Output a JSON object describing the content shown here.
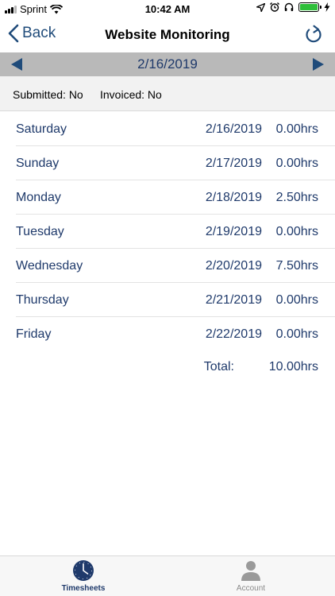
{
  "status_bar": {
    "carrier": "Sprint",
    "time": "10:42 AM",
    "icons": [
      "signal-icon",
      "wifi-icon",
      "location-icon",
      "alarm-icon",
      "headphones-icon",
      "battery-icon",
      "charging-icon"
    ]
  },
  "nav": {
    "back_label": "Back",
    "title": "Website Monitoring"
  },
  "date_bar": {
    "date": "2/16/2019"
  },
  "info": {
    "submitted": "Submitted: No",
    "invoiced": "Invoiced: No"
  },
  "days": [
    {
      "name": "Saturday",
      "date": "2/16/2019",
      "hours": "0.00hrs"
    },
    {
      "name": "Sunday",
      "date": "2/17/2019",
      "hours": "0.00hrs"
    },
    {
      "name": "Monday",
      "date": "2/18/2019",
      "hours": "2.50hrs"
    },
    {
      "name": "Tuesday",
      "date": "2/19/2019",
      "hours": "0.00hrs"
    },
    {
      "name": "Wednesday",
      "date": "2/20/2019",
      "hours": "7.50hrs"
    },
    {
      "name": "Thursday",
      "date": "2/21/2019",
      "hours": "0.00hrs"
    },
    {
      "name": "Friday",
      "date": "2/22/2019",
      "hours": "0.00hrs"
    }
  ],
  "total": {
    "label": "Total:",
    "value": "10.00hrs"
  },
  "tabs": [
    {
      "label": "Timesheets",
      "icon": "clock-icon",
      "active": true
    },
    {
      "label": "Account",
      "icon": "person-icon",
      "active": false
    }
  ],
  "colors": {
    "accent": "#1f3a6b",
    "date_bar_bg": "#b9b9b9",
    "info_bg": "#f2f2f2",
    "battery": "#2fbf3a"
  }
}
